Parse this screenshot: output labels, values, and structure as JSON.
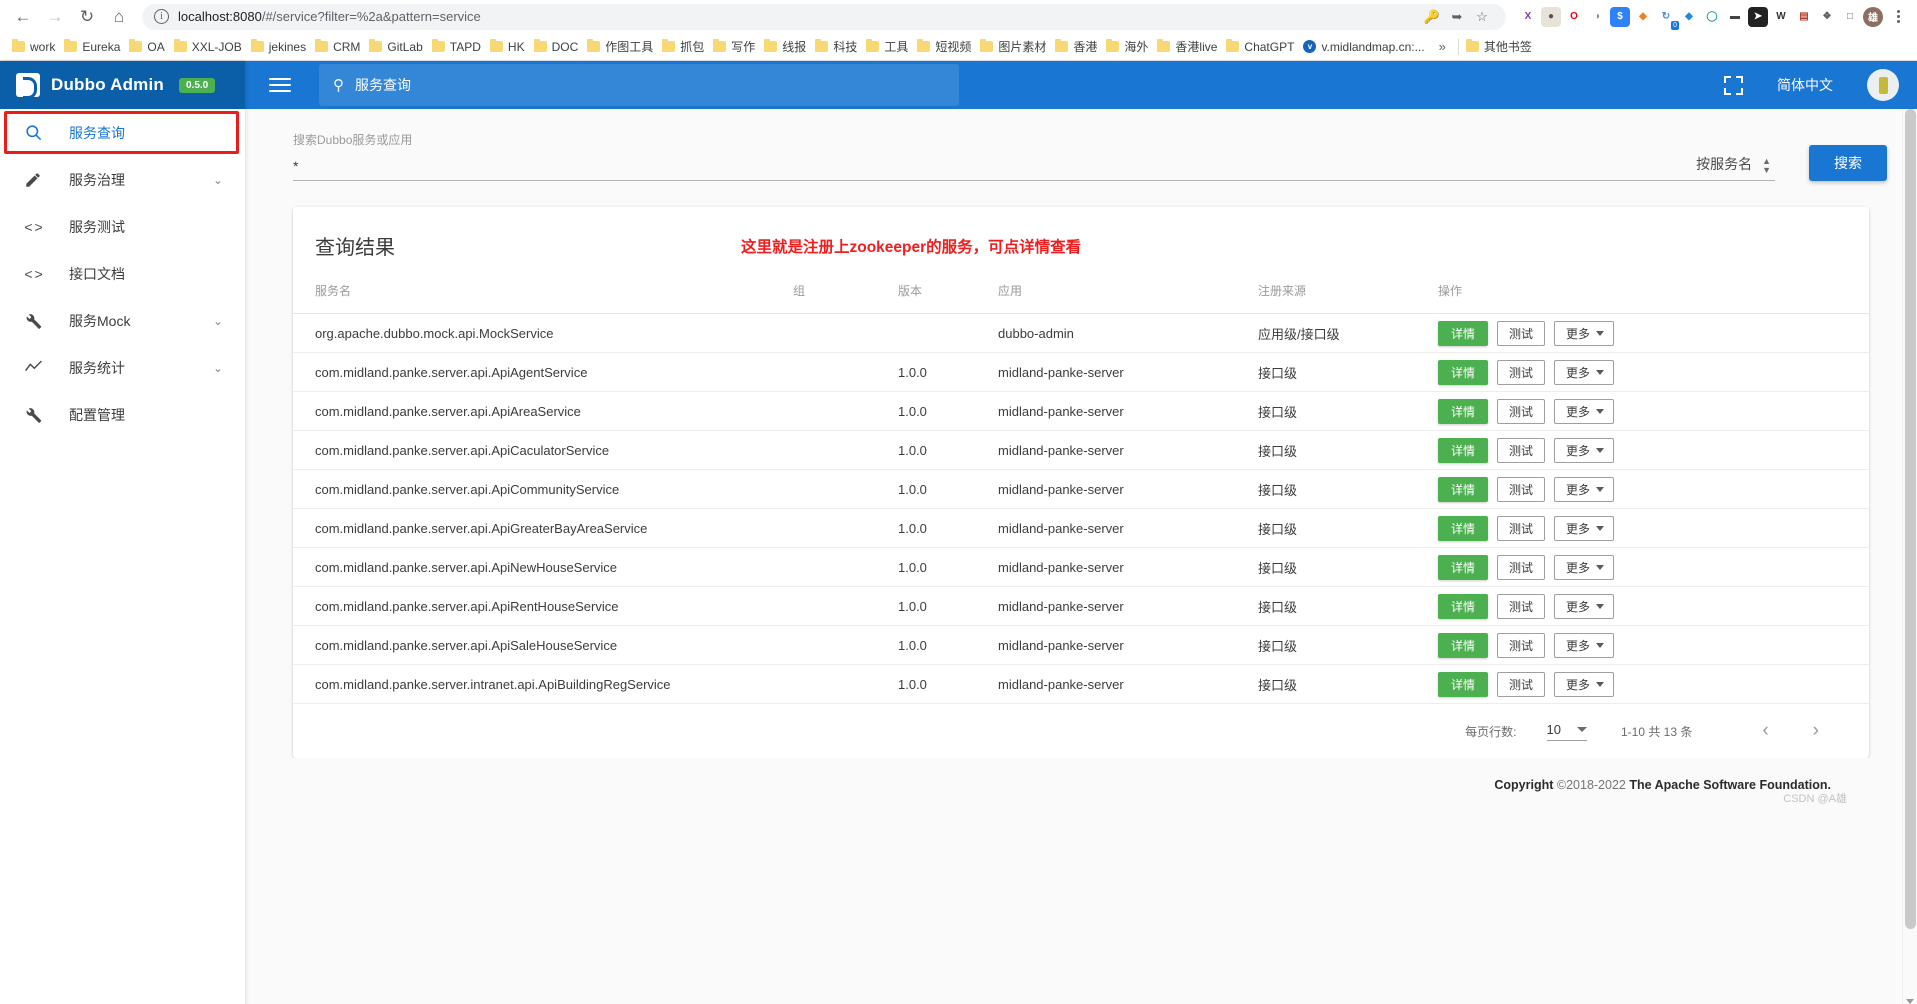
{
  "browser": {
    "url_prefix": "localhost:8080",
    "url_path": "/#/service?filter=%2a&pattern=service",
    "nav": {
      "back": "←",
      "forward": "→",
      "reload": "↻",
      "home": "⌂"
    },
    "omnibox_icons": [
      "key-icon",
      "share-icon",
      "star-icon"
    ],
    "extensions": [
      {
        "name": "x-extension",
        "glyph": "X",
        "color": "#ffffff",
        "fg": "#7b3fb5"
      },
      {
        "name": "panda-extension",
        "glyph": "●",
        "color": "#e8e3d8",
        "fg": "#555"
      },
      {
        "name": "opera-extension",
        "glyph": "O",
        "color": "#ffffff",
        "fg": "#e8000d"
      },
      {
        "name": "bookmark-extension",
        "glyph": "◑",
        "color": "#ffffff",
        "fg": "#8b8b8b"
      },
      {
        "name": "dollar-extension",
        "glyph": "$",
        "color": "#2f81f7",
        "fg": "#ffffff"
      },
      {
        "name": "flame-extension",
        "glyph": "◆",
        "color": "#ffffff",
        "fg": "#f47b20"
      },
      {
        "name": "sync-extension",
        "glyph": "↻",
        "color": "#ffffff",
        "fg": "#4a8cd8",
        "badge": "0"
      },
      {
        "name": "drop-extension",
        "glyph": "◆",
        "color": "#ffffff",
        "fg": "#1e88e5"
      },
      {
        "name": "chat-extension",
        "glyph": "◯",
        "color": "#ffffff",
        "fg": "#26a69a"
      },
      {
        "name": "mask-extension",
        "glyph": "▬",
        "color": "#ffffff",
        "fg": "#444"
      },
      {
        "name": "send-extension",
        "glyph": "➤",
        "color": "#222222",
        "fg": "#ffffff"
      },
      {
        "name": "wiki-extension",
        "glyph": "W",
        "color": "#ffffff",
        "fg": "#333"
      },
      {
        "name": "reader-extension",
        "glyph": "▤",
        "color": "#ffffff",
        "fg": "#b5442a"
      },
      {
        "name": "puzzle-extension",
        "glyph": "❖",
        "color": "#ffffff",
        "fg": "#5f6368"
      },
      {
        "name": "sidepanel-extension",
        "glyph": "□",
        "color": "#ffffff",
        "fg": "#5f6368"
      },
      {
        "name": "profile-avatar",
        "glyph": "雄",
        "color": "#8d6e63",
        "fg": "#ffffff"
      }
    ],
    "bookmarks": [
      {
        "label": "work",
        "type": "folder"
      },
      {
        "label": "Eureka",
        "type": "folder"
      },
      {
        "label": "OA",
        "type": "folder"
      },
      {
        "label": "XXL-JOB",
        "type": "folder"
      },
      {
        "label": "jekines",
        "type": "folder"
      },
      {
        "label": "CRM",
        "type": "folder"
      },
      {
        "label": "GitLab",
        "type": "folder"
      },
      {
        "label": "TAPD",
        "type": "folder"
      },
      {
        "label": "HK",
        "type": "folder"
      },
      {
        "label": "DOC",
        "type": "folder"
      },
      {
        "label": "作图工具",
        "type": "folder"
      },
      {
        "label": "抓包",
        "type": "folder"
      },
      {
        "label": "写作",
        "type": "folder"
      },
      {
        "label": "线报",
        "type": "folder"
      },
      {
        "label": "科技",
        "type": "folder"
      },
      {
        "label": "工具",
        "type": "folder"
      },
      {
        "label": "短视频",
        "type": "folder"
      },
      {
        "label": "图片素材",
        "type": "folder"
      },
      {
        "label": "香港",
        "type": "folder"
      },
      {
        "label": "海外",
        "type": "folder"
      },
      {
        "label": "香港live",
        "type": "folder"
      },
      {
        "label": "ChatGPT",
        "type": "folder"
      },
      {
        "label": "v.midlandmap.cn:...",
        "type": "site"
      }
    ],
    "bookmarks_overflow": "»",
    "other_bookmarks": "其他书签"
  },
  "sidebar": {
    "brand": {
      "name": "Dubbo Admin",
      "version": "0.5.0"
    },
    "items": [
      {
        "label": "服务查询",
        "icon": "search-icon",
        "active": true,
        "expandable": false
      },
      {
        "label": "服务治理",
        "icon": "pencil-icon",
        "active": false,
        "expandable": true
      },
      {
        "label": "服务测试",
        "icon": "code-icon",
        "active": false,
        "expandable": false
      },
      {
        "label": "接口文档",
        "icon": "code-icon",
        "active": false,
        "expandable": false
      },
      {
        "label": "服务Mock",
        "icon": "wrench-icon",
        "active": false,
        "expandable": true
      },
      {
        "label": "服务统计",
        "icon": "chart-line-icon",
        "active": false,
        "expandable": true
      },
      {
        "label": "配置管理",
        "icon": "wrench-icon",
        "active": false,
        "expandable": false
      }
    ]
  },
  "appbar": {
    "search_text": "服务查询",
    "language": "简体中文"
  },
  "search_panel": {
    "label": "搜索Dubbo服务或应用",
    "value": "*",
    "mode": "按服务名",
    "button": "搜索"
  },
  "results": {
    "title": "查询结果",
    "annotation": "这里就是注册上zookeeper的服务，可点详情查看",
    "columns": [
      "服务名",
      "组",
      "版本",
      "应用",
      "注册来源",
      "操作"
    ],
    "action_labels": {
      "detail": "详情",
      "test": "测试",
      "more": "更多"
    },
    "rows": [
      {
        "service": "org.apache.dubbo.mock.api.MockService",
        "group": "",
        "version": "",
        "app": "dubbo-admin",
        "source": "应用级/接口级"
      },
      {
        "service": "com.midland.panke.server.api.ApiAgentService",
        "group": "",
        "version": "1.0.0",
        "app": "midland-panke-server",
        "source": "接口级"
      },
      {
        "service": "com.midland.panke.server.api.ApiAreaService",
        "group": "",
        "version": "1.0.0",
        "app": "midland-panke-server",
        "source": "接口级"
      },
      {
        "service": "com.midland.panke.server.api.ApiCaculatorService",
        "group": "",
        "version": "1.0.0",
        "app": "midland-panke-server",
        "source": "接口级"
      },
      {
        "service": "com.midland.panke.server.api.ApiCommunityService",
        "group": "",
        "version": "1.0.0",
        "app": "midland-panke-server",
        "source": "接口级"
      },
      {
        "service": "com.midland.panke.server.api.ApiGreaterBayAreaService",
        "group": "",
        "version": "1.0.0",
        "app": "midland-panke-server",
        "source": "接口级"
      },
      {
        "service": "com.midland.panke.server.api.ApiNewHouseService",
        "group": "",
        "version": "1.0.0",
        "app": "midland-panke-server",
        "source": "接口级"
      },
      {
        "service": "com.midland.panke.server.api.ApiRentHouseService",
        "group": "",
        "version": "1.0.0",
        "app": "midland-panke-server",
        "source": "接口级"
      },
      {
        "service": "com.midland.panke.server.api.ApiSaleHouseService",
        "group": "",
        "version": "1.0.0",
        "app": "midland-panke-server",
        "source": "接口级"
      },
      {
        "service": "com.midland.panke.server.intranet.api.ApiBuildingRegService",
        "group": "",
        "version": "1.0.0",
        "app": "midland-panke-server",
        "source": "接口级"
      }
    ],
    "pagination": {
      "rows_label": "每页行数:",
      "rows_value": "10",
      "range": "1-10 共 13 条",
      "prev": "‹",
      "next": "›"
    }
  },
  "footer": {
    "copyright_bold": "Copyright",
    "copyright_years": "©2018-2022",
    "copyright_org": "The Apache Software Foundation.",
    "watermark": "CSDN @A雄"
  },
  "colors": {
    "brand_dark": "#0b5ea8",
    "appbar_blue": "#1976d2",
    "accent_green": "#4caf50",
    "annotation_red": "#f01e1e",
    "highlight_red": "#ee1b1b"
  }
}
